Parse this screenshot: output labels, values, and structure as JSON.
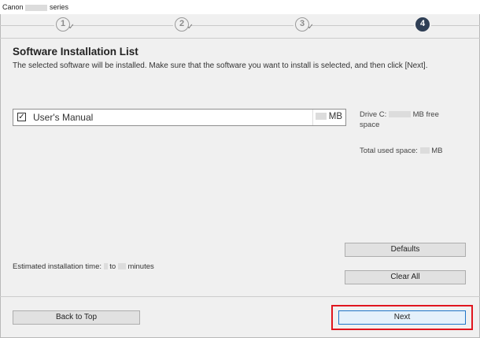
{
  "window": {
    "title_prefix": "Canon",
    "title_suffix": "series"
  },
  "steps": [
    {
      "label": "1",
      "state": "done"
    },
    {
      "label": "2",
      "state": "done"
    },
    {
      "label": "3",
      "state": "done"
    },
    {
      "label": "4",
      "state": "current"
    }
  ],
  "page": {
    "title": "Software Installation List",
    "description": "The selected software will be installed. Make sure that the software you want to install is selected, and then click [Next]."
  },
  "software_list": [
    {
      "name": "User's Manual",
      "checked": true,
      "size_unit": "MB"
    }
  ],
  "disk": {
    "drive_label": "Drive C:",
    "free_unit": "MB free",
    "free_tail": "space",
    "total_label": "Total used space:",
    "total_unit": "MB"
  },
  "estimate": {
    "label": "Estimated installation time:",
    "to": "to",
    "unit": "minutes"
  },
  "buttons": {
    "defaults": "Defaults",
    "clear_all": "Clear All",
    "back_to_top": "Back to Top",
    "next": "Next"
  },
  "colors": {
    "highlight": "#e0161e",
    "step_active": "#2f3f55"
  }
}
